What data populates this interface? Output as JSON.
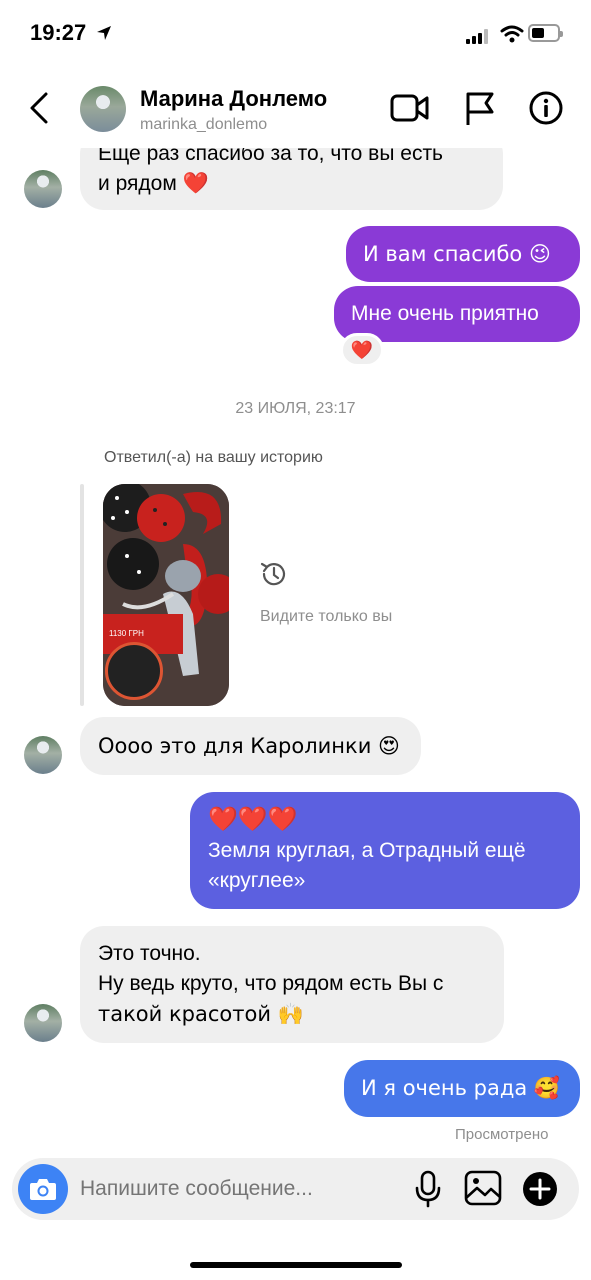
{
  "status_bar": {
    "time": "19:27"
  },
  "header": {
    "name": "Марина Донлемо",
    "username": "marinka_donlemo"
  },
  "messages": {
    "m1_line1": "Еще раз спасибо за то, что вы есть",
    "m1_line2": "и рядом ❤️",
    "m2": "И вам спасибо 😉",
    "m3": "Мне очень приятно",
    "m3_reaction": "❤️",
    "date_separator": "23 ИЮЛЯ, 23:17",
    "story_reply_label": "Ответил(-а) на вашу историю",
    "story_price": "1130 ГРН",
    "story_visibility": "Видите только вы",
    "m4": "Оооо это для Каролинки 😍",
    "m5_line1": "❤️❤️❤️",
    "m5_line2": "Земля круглая, а Отрадный ещё",
    "m5_line3": "«круглее»",
    "m6_line1": "Это точно.",
    "m6_line2": "Ну ведь круто, что рядом есть Вы с",
    "m6_line3": "такой красотой 🙌",
    "m7": "И я очень рада 🥰",
    "seen_status": "Просмотрено"
  },
  "composer": {
    "placeholder": "Напишите сообщение..."
  },
  "icons": {
    "back": "chevron-left-icon",
    "video": "video-camera-icon",
    "report": "flag-icon",
    "info": "info-icon",
    "camera": "camera-icon",
    "mic": "microphone-icon",
    "gallery": "image-icon",
    "add": "plus-icon",
    "history": "history-icon"
  },
  "colors": {
    "accent_purple": "#8a3ad6",
    "accent_indigo": "#5c60e0",
    "accent_blue": "#4777ea",
    "incoming": "#efefef",
    "camera_button": "#3d83f5"
  }
}
